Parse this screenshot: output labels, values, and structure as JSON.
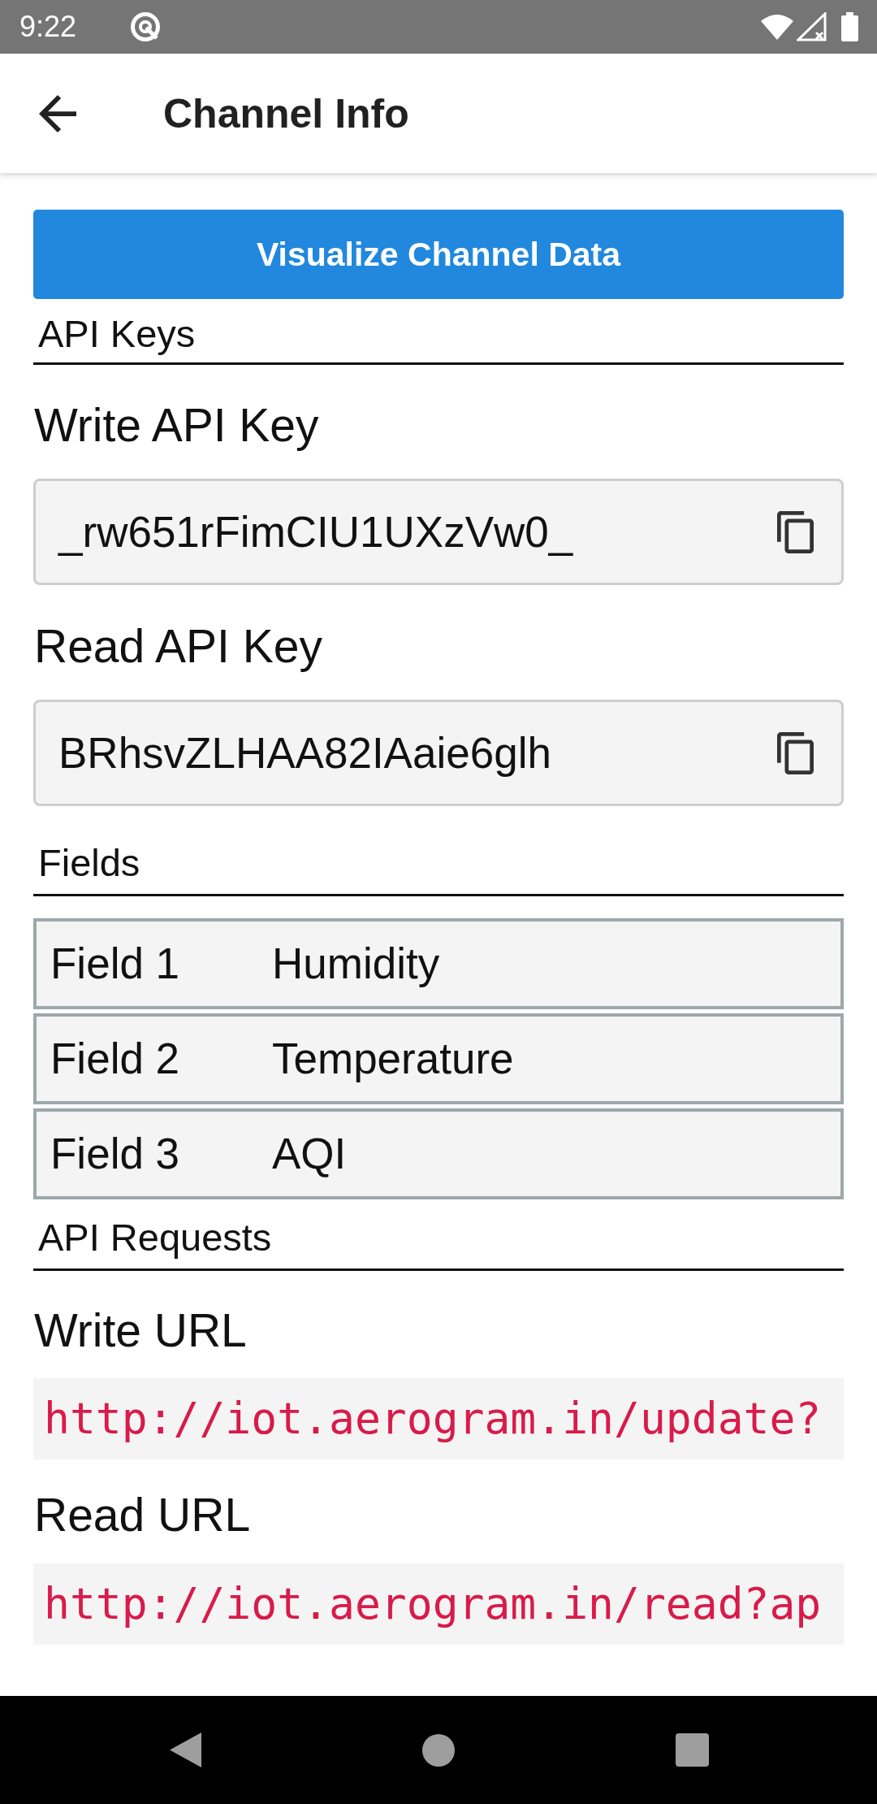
{
  "status_bar": {
    "time": "9:22"
  },
  "app_bar": {
    "title": "Channel Info"
  },
  "visualize_button": {
    "label": "Visualize Channel Data"
  },
  "api_keys": {
    "heading": "API Keys",
    "keys": [
      {
        "label": "Write API Key",
        "value": "_rw651rFimCIU1UXzVw0_"
      },
      {
        "label": "Read API Key",
        "value": "BRhsvZLHAA82IAaie6glh"
      }
    ]
  },
  "fields": {
    "heading": "Fields",
    "rows": [
      {
        "name": "Field 1",
        "value": "Humidity"
      },
      {
        "name": "Field 2",
        "value": "Temperature"
      },
      {
        "name": "Field 3",
        "value": "AQI"
      }
    ]
  },
  "api_requests": {
    "heading": "API Requests",
    "urls": [
      {
        "label": "Write URL",
        "value": "http://iot.aerogram.in/update?"
      },
      {
        "label": "Read URL",
        "value": "http://iot.aerogram.in/read?ap"
      }
    ]
  }
}
